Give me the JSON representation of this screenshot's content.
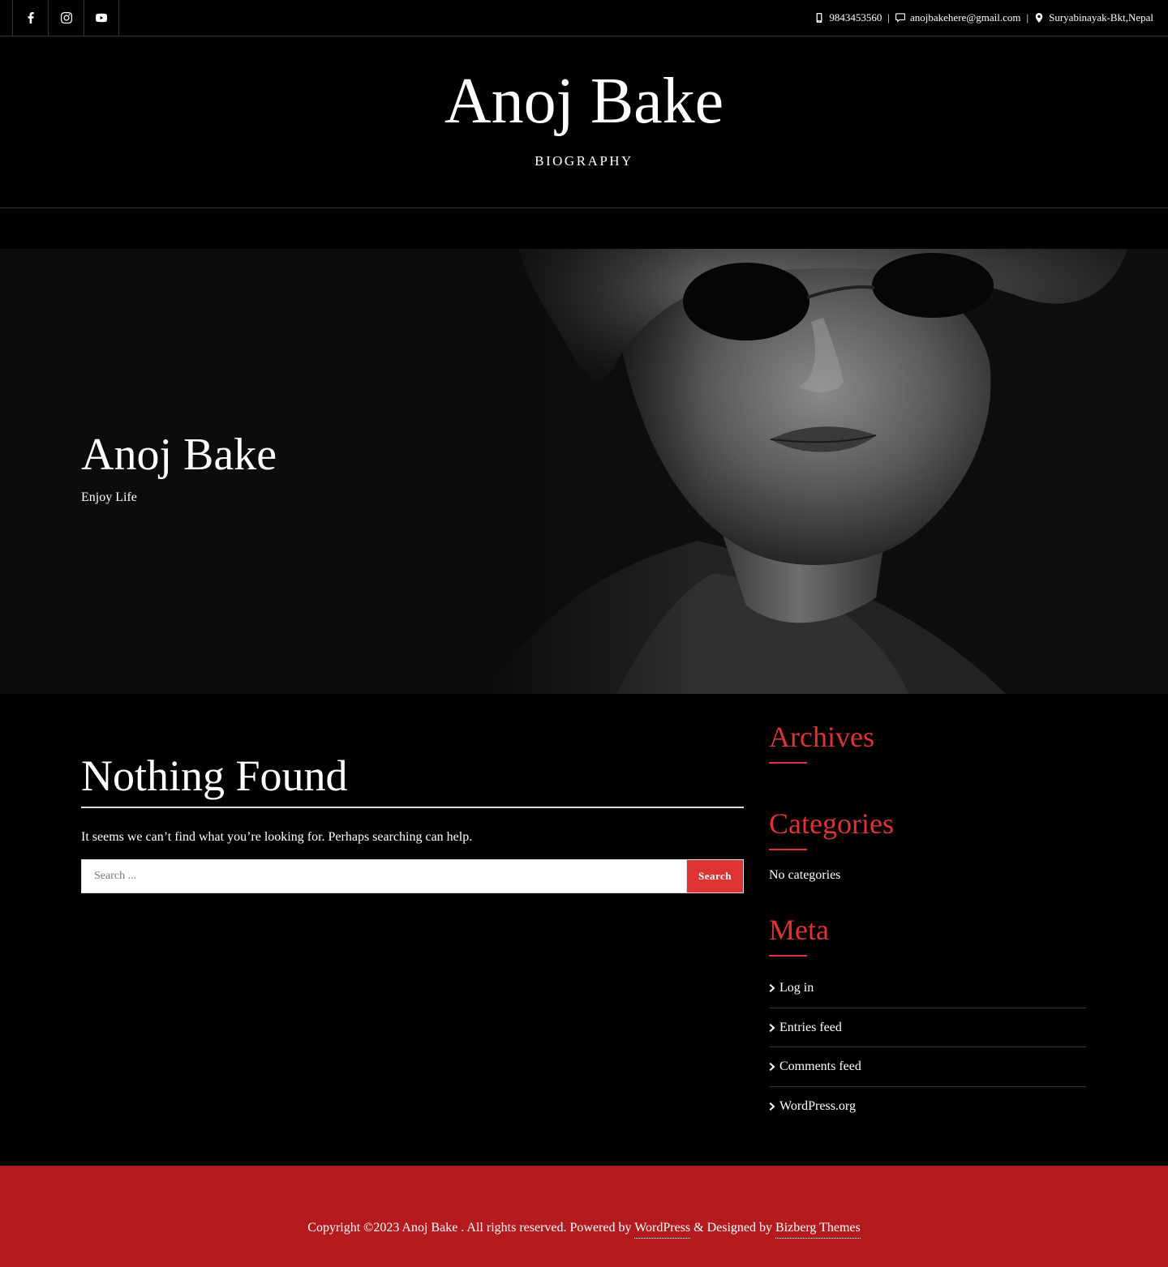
{
  "topbar": {
    "social": [
      {
        "name": "facebook-icon"
      },
      {
        "name": "instagram-icon"
      },
      {
        "name": "youtube-icon"
      }
    ],
    "phone": "9843453560",
    "email": "anojbakehere@gmail.com",
    "address": "Suryabinayak-Bkt,Nepal",
    "separator": "|"
  },
  "header": {
    "site_title": "Anoj Bake",
    "tagline": "BIOGRAPHY"
  },
  "hero": {
    "title": "Anoj Bake",
    "subtitle": "Enjoy Life"
  },
  "main": {
    "title": "Nothing Found",
    "message": "It seems we can’t find what you’re looking for. Perhaps searching can help.",
    "search_placeholder": "Search ...",
    "search_button": "Search"
  },
  "sidebar": {
    "archives_title": "Archives",
    "categories_title": "Categories",
    "categories_empty": "No categories",
    "meta_title": "Meta",
    "meta_links": [
      "Log in",
      "Entries feed",
      "Comments feed",
      "WordPress.org"
    ]
  },
  "footer": {
    "prefix": "Copyright ©2023 Anoj Bake . All rights reserved. Powered by",
    "wordpress": "WordPress",
    "designed": "& Designed by",
    "theme": "Bizberg Themes"
  },
  "colors": {
    "accent": "#dd3333",
    "footer_bg": "#b31b1e",
    "background": "#000000"
  }
}
